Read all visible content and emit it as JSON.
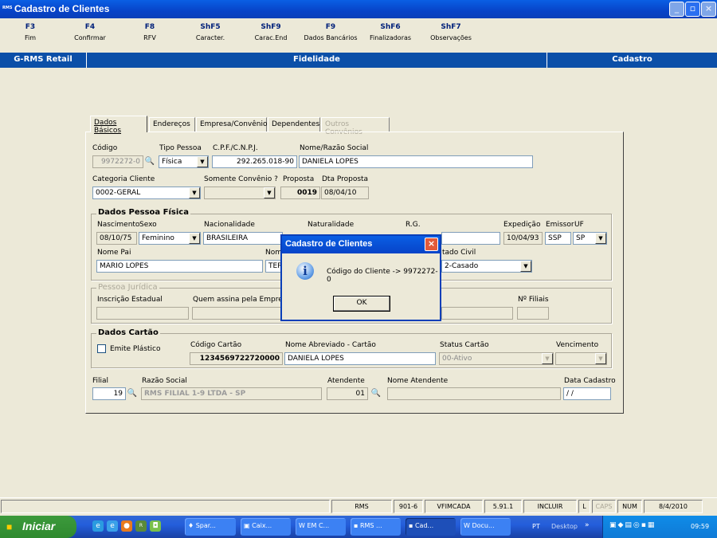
{
  "window": {
    "title": "Cadastro de Clientes",
    "logo": "RMS",
    "minimize": "_",
    "maximize": "▫",
    "close": "×"
  },
  "fkeys": [
    {
      "key": "F3",
      "label": "Fim"
    },
    {
      "key": "F4",
      "label": "Confirmar"
    },
    {
      "key": "F8",
      "label": "RFV"
    },
    {
      "key": "ShF5",
      "label": "Caracter."
    },
    {
      "key": "ShF9",
      "label": "Carac.End"
    },
    {
      "key": "F9",
      "label": "Dados Bancários"
    },
    {
      "key": "ShF6",
      "label": "Finalizadoras"
    },
    {
      "key": "ShF7",
      "label": "Observações"
    }
  ],
  "header": {
    "left": "G-RMS Retail",
    "center": "Fidelidade",
    "right": "Cadastro"
  },
  "tabs": [
    {
      "label": "Dados Básicos"
    },
    {
      "label": "Endereços"
    },
    {
      "label": "Empresa/Convênio"
    },
    {
      "label": "Dependentes"
    },
    {
      "label": "Outros Convênios"
    }
  ],
  "basic": {
    "codigo_label": "Código",
    "codigo_value": "9972272-0",
    "tipo_label": "Tipo Pessoa",
    "tipo_value": "Física",
    "cpf_label": "C.P.F./C.N.P.J.",
    "cpf_value": "292.265.018-90",
    "nome_label": "Nome/Razão Social",
    "nome_value": "DANIELA LOPES",
    "categoria_label": "Categoria Cliente",
    "categoria_value": "0002-GERAL",
    "convenio_label": "Somente Convênio ?",
    "convenio_value": "",
    "proposta_label": "Proposta",
    "proposta_value": "0019",
    "dta_label": "Dta Proposta",
    "dta_value": "08/04/10"
  },
  "pf": {
    "title": "Dados Pessoa Física",
    "nasc_label": "Nascimento",
    "nasc_value": "08/10/75",
    "sexo_label": "Sexo",
    "sexo_value": "Feminino",
    "nac_label": "Nacionalidade",
    "nac_value": "BRASILEIRA",
    "nat_label": "Naturalidade",
    "rg_label": "R.G.",
    "exp_label": "Expedição",
    "exp_value": "10/04/93",
    "emissor_label": "Emissor",
    "emissor_value": "SSP",
    "uf_label": "UF",
    "uf_value": "SP",
    "pai_label": "Nome Pai",
    "pai_value": "MARIO LOPES",
    "mae_label": "Nom",
    "mae_value": "TER",
    "civil_label": "tado Civil",
    "civil_value": "2-Casado"
  },
  "pj": {
    "title": "Pessoa Jurídica",
    "ie_label": "Inscrição Estadual",
    "assina_label": "Quem assina pela Empresa",
    "filiais_label": "Nº Filiais"
  },
  "cartao": {
    "title": "Dados Cartão",
    "emite_label": "Emite Plástico",
    "codigo_label": "Código Cartão",
    "codigo_value": "1234569722720000",
    "nome_label": "Nome Abreviado - Cartão",
    "nome_value": "DANIELA LOPES",
    "status_label": "Status Cartão",
    "status_value": "00-Ativo",
    "venc_label": "Vencimento",
    "venc_value": ""
  },
  "footer": {
    "filial_label": "Filial",
    "filial_value": "19",
    "razao_label": "Razão Social",
    "razao_value": "RMS FILIAL 1-9 LTDA - SP",
    "atendente_label": "Atendente",
    "atendente_value": "01",
    "nome_at_label": "Nome Atendente",
    "nome_at_value": "",
    "data_label": "Data Cadastro",
    "data_value": "/  /"
  },
  "dialog": {
    "title": "Cadastro de Clientes",
    "message": "Código do Cliente -> 9972272-0",
    "ok": "OK",
    "icon": "info-icon"
  },
  "status": [
    "RMS",
    "901-6",
    "VFIMCADA",
    "5.91.1",
    "INCLUIR",
    "L",
    "CAPS",
    "NUM",
    "8/4/2010"
  ],
  "taskbar": {
    "start": "Iniciar",
    "items": [
      "Spar...",
      "Caix...",
      "EM C...",
      "RMS ...",
      "Cad...",
      "Docu..."
    ],
    "lang": "PT",
    "desktop": "Desktop",
    "clock": "09:59"
  }
}
